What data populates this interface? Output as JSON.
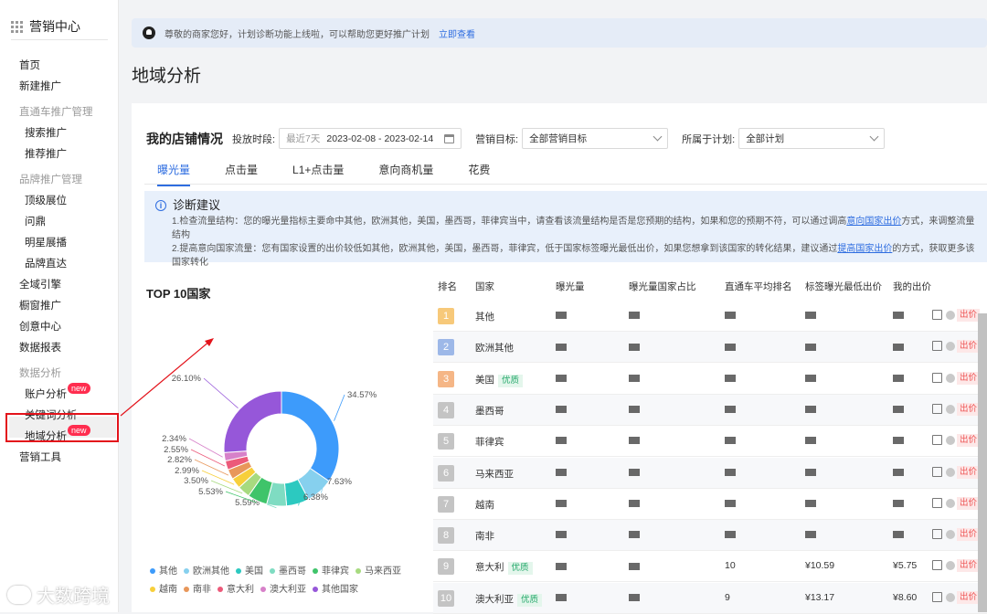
{
  "sidebar": {
    "title": "营销中心",
    "items": [
      {
        "label": "首页",
        "group": false
      },
      {
        "label": "新建推广",
        "group": false
      },
      {
        "label": "直通车推广管理",
        "group": true
      },
      {
        "label": "搜索推广",
        "group": false
      },
      {
        "label": "推荐推广",
        "group": false
      },
      {
        "label": "品牌推广管理",
        "group": true
      },
      {
        "label": "顶级展位",
        "group": false
      },
      {
        "label": "问鼎",
        "group": false
      },
      {
        "label": "明星展播",
        "group": false
      },
      {
        "label": "品牌直达",
        "group": false
      },
      {
        "label": "全域引擎",
        "group": false
      },
      {
        "label": "橱窗推广",
        "group": false
      },
      {
        "label": "创意中心",
        "group": false
      },
      {
        "label": "数据报表",
        "group": false
      },
      {
        "label": "数据分析",
        "group": true
      },
      {
        "label": "账户分析",
        "group": false,
        "badge": "new"
      },
      {
        "label": "关键词分析",
        "group": false
      },
      {
        "label": "地域分析",
        "group": false,
        "badge": "new",
        "active": true
      },
      {
        "label": "营销工具",
        "group": false
      }
    ]
  },
  "notice": {
    "text": "尊敬的商家您好，计划诊断功能上线啦，可以帮助您更好推广计划",
    "link": "立即查看"
  },
  "page_title": "地域分析",
  "filters": {
    "store_title": "我的店铺情况",
    "period_label": "投放时段:",
    "period_preset": "最近7天",
    "period_range": "2023-02-08 - 2023-02-14",
    "goal_label": "营销目标:",
    "goal_value": "全部营销目标",
    "plan_label": "所属于计划:",
    "plan_value": "全部计划"
  },
  "tabs": [
    "曝光量",
    "点击量",
    "L1+点击量",
    "意向商机量",
    "花费"
  ],
  "diagnosis": {
    "title": "诊断建议",
    "line1_a": "1.检查流量结构：您的曝光量指标主要命中其他，欧洲其他，美国，墨西哥，菲律宾当中，请查看该流量结构是否是您预期的结构，如果和您的预期不符，可以通过调高",
    "line1_link": "意向国家出价",
    "line1_b": "方式，来调整流量结构",
    "line2_a": "2.提高意向国家流量：您有国家设置的出价较低如其他，欧洲其他，美国，墨西哥，菲律宾，低于国家标签曝光最低出价，如果您想拿到该国家的转化结果，建议通过",
    "line2_link": "提高国家出价",
    "line2_b": "的方式，获取更多该国家转化"
  },
  "top10_title": "TOP 10国家",
  "table": {
    "headers": [
      "排名",
      "国家",
      "曝光量",
      "曝光量国家占比",
      "直通车平均排名",
      "标签曝光最低出价",
      "我的出价"
    ],
    "bid_button": "出价",
    "good_tag": "优质",
    "rows": [
      {
        "rank": "1",
        "country": "其他",
        "good": false,
        "visible_low": "",
        "visible_bid": ""
      },
      {
        "rank": "2",
        "country": "欧洲其他",
        "good": false,
        "visible_low": "",
        "visible_bid": ""
      },
      {
        "rank": "3",
        "country": "美国",
        "good": true,
        "visible_low": "",
        "visible_bid": ""
      },
      {
        "rank": "4",
        "country": "墨西哥",
        "good": false,
        "visible_low": "",
        "visible_bid": ""
      },
      {
        "rank": "5",
        "country": "菲律宾",
        "good": false,
        "visible_low": "",
        "visible_bid": ""
      },
      {
        "rank": "6",
        "country": "马来西亚",
        "good": false,
        "visible_low": "",
        "visible_bid": ""
      },
      {
        "rank": "7",
        "country": "越南",
        "good": false,
        "visible_low": "",
        "visible_bid": ""
      },
      {
        "rank": "8",
        "country": "南非",
        "good": false,
        "visible_low": "",
        "visible_bid": ""
      },
      {
        "rank": "9",
        "country": "意大利",
        "good": true,
        "visible_rankavg": "10",
        "visible_low": "¥10.59",
        "visible_bid": "¥5.75"
      },
      {
        "rank": "10",
        "country": "澳大利亚",
        "good": true,
        "visible_rankavg": "9",
        "visible_low": "¥13.17",
        "visible_bid": "¥8.60"
      }
    ]
  },
  "chart_data": {
    "type": "pie",
    "title": "TOP 10国家",
    "donut": true,
    "categories": [
      "其他",
      "欧洲其他",
      "美国",
      "墨西哥",
      "菲律宾",
      "马来西亚",
      "越南",
      "南非",
      "意大利",
      "澳大利亚",
      "其他国家"
    ],
    "values": [
      34.57,
      7.63,
      6.38,
      5.59,
      5.53,
      3.5,
      2.99,
      2.82,
      2.55,
      2.34,
      26.1
    ],
    "labels": [
      "34.57%",
      "7.63%",
      "6.38%",
      "5.59%",
      "5.53%",
      "3.50%",
      "2.99%",
      "2.82%",
      "2.55%",
      "2.34%",
      "26.10%"
    ],
    "colors": [
      "#3d9bfb",
      "#86d0ee",
      "#2cc9c0",
      "#7fdcc2",
      "#3fc46a",
      "#a7da7f",
      "#f7cf3b",
      "#e8975a",
      "#ec5a7a",
      "#d781c9",
      "#9657d9"
    ],
    "legend_position": "bottom"
  },
  "watermark": "大数跨境"
}
